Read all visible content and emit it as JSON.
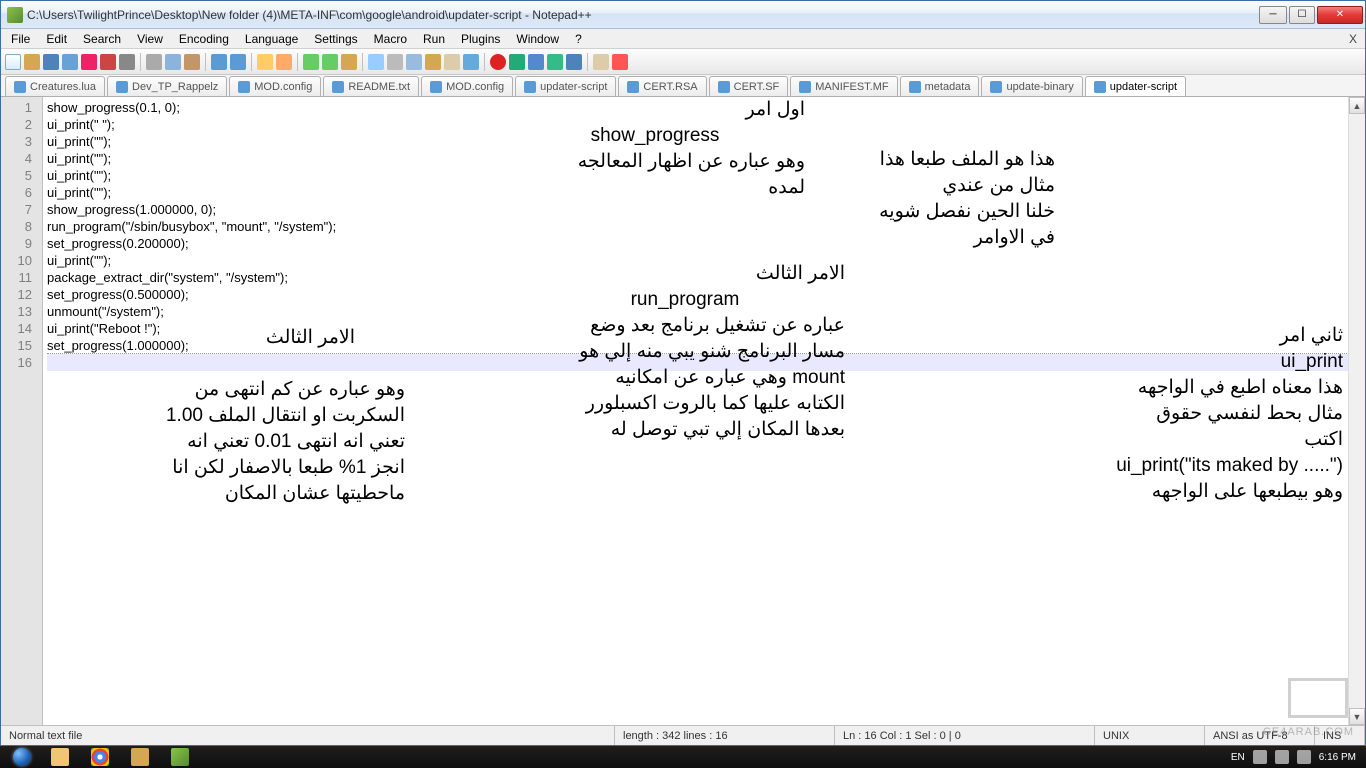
{
  "window": {
    "title": "C:\\Users\\TwilightPrince\\Desktop\\New folder (4)\\META-INF\\com\\google\\android\\updater-script - Notepad++"
  },
  "menu": {
    "items": [
      "File",
      "Edit",
      "Search",
      "View",
      "Encoding",
      "Language",
      "Settings",
      "Macro",
      "Run",
      "Plugins",
      "Window",
      "?"
    ]
  },
  "tabs": [
    {
      "label": "Creatures.lua"
    },
    {
      "label": "Dev_TP_Rappelz"
    },
    {
      "label": "MOD.config"
    },
    {
      "label": "README.txt"
    },
    {
      "label": "MOD.config"
    },
    {
      "label": "updater-script"
    },
    {
      "label": "CERT.RSA"
    },
    {
      "label": "CERT.SF"
    },
    {
      "label": "MANIFEST.MF"
    },
    {
      "label": "metadata"
    },
    {
      "label": "update-binary"
    },
    {
      "label": "updater-script"
    }
  ],
  "active_tab_index": 11,
  "code": {
    "lines": [
      "show_progress(0.1, 0);",
      "ui_print(\" \");",
      "ui_print(\"\");",
      "ui_print(\"\");",
      "ui_print(\"\");",
      "ui_print(\"\");",
      "show_progress(1.000000, 0);",
      "run_program(\"/sbin/busybox\", \"mount\", \"/system\");",
      "set_progress(0.200000);",
      "ui_print(\"\");",
      "package_extract_dir(\"system\", \"/system\");",
      "set_progress(0.500000);",
      "unmount(\"/system\");",
      "ui_print(\"Reboot !\");",
      "set_progress(1.000000);",
      ""
    ],
    "current_line": 16
  },
  "annotations": {
    "a1": {
      "l1": "اول امر",
      "l2": "show_progress",
      "l3": "وهو عباره عن اظهار المعالجه",
      "l4": "لمده"
    },
    "a2": {
      "l1": "هذا هو الملف طبعا هذا",
      "l2": "مثال من عندي",
      "l3": "خلنا الحين نفصل شويه",
      "l4": "في الاوامر"
    },
    "a3": {
      "l1": "الامر الثالث",
      "l2": "run_program",
      "l3": "عباره عن تشغيل برنامج بعد وضع",
      "l4": "مسار البرنامج شنو يبي منه إلي هو",
      "l5": "mount وهي عباره عن امكانيه",
      "l6": "الكتابه عليها  كما بالروت اكسبلورر",
      "l7": "بعدها المكان إلي تبي توصل له"
    },
    "a4": {
      "l1": "ثاني امر",
      "l2": "ui_print",
      "l3": "هذا معناه اطبع في الواجهه",
      "l4": "مثال بحط لنفسي  حقوق",
      "l5": "اكتب",
      "l6": "ui_print(\"its maked by .....\")",
      "l7": "وهو بيطبعها على الواجهه"
    },
    "a5": {
      "l1": "الامر الثالث"
    },
    "a6": {
      "l1": "وهو عباره عن كم انتهى من",
      "l2": "السكربت او انتقال الملف 1.00",
      "l3": "تعني انه انتهى 0.01  تعني انه",
      "l4": "انجز 1% طبعا بالاصفار لكن انا",
      "l5": "ماحطيتها عشان المكان"
    }
  },
  "status": {
    "file_type": "Normal text file",
    "length": "length : 342    lines : 16",
    "pos": "Ln : 16    Col : 1    Sel : 0 | 0",
    "eol": "UNIX",
    "encoding": "ANSI as UTF-8",
    "mode": "INS"
  },
  "tray": {
    "lang": "EN",
    "time": "6:16 PM"
  },
  "watermark": "CE4ARAB.COM"
}
